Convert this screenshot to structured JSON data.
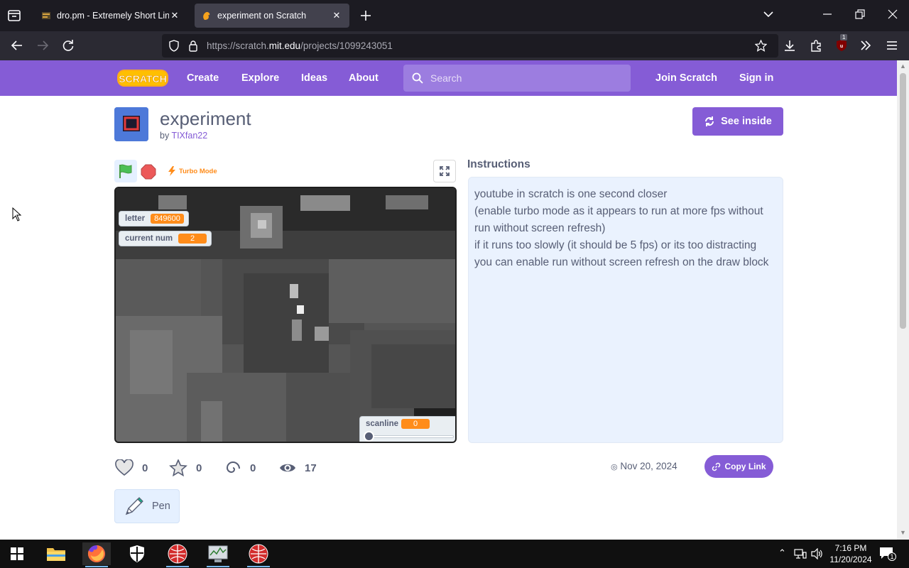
{
  "browser": {
    "tabs": [
      {
        "label": "dro.pm - Extremely Short Links",
        "active": false
      },
      {
        "label": "experiment on Scratch",
        "active": true
      }
    ],
    "url": {
      "prefix": "https://scratch.",
      "host": "mit.edu",
      "path": "/projects/1099243051"
    },
    "extension_badge": "1"
  },
  "scratch": {
    "logo_text": "SCRATCH",
    "nav": {
      "create": "Create",
      "explore": "Explore",
      "ideas": "Ideas",
      "about": "About"
    },
    "search": {
      "placeholder": "Search"
    },
    "join": "Join Scratch",
    "signin": "Sign in"
  },
  "project": {
    "title": "experiment",
    "by": "by",
    "author": "TIXfan22",
    "see_inside": "See inside",
    "turbo": "Turbo Mode",
    "monitors": {
      "letter": {
        "label": "letter",
        "value": "849600"
      },
      "current_num": {
        "label": "current num",
        "value": "2"
      },
      "scanline": {
        "label": "scanline",
        "value": "0"
      }
    },
    "instructions_heading": "Instructions",
    "instructions": [
      "youtube in scratch is one second closer",
      "(enable turbo mode as it appears to run at more fps without run without screen refresh)",
      "if it runs too slowly (it should be 5 fps) or its too distracting you can enable run without screen refresh on the draw block"
    ],
    "stats": {
      "loves": "0",
      "favorites": "0",
      "remixes": "0",
      "views": "17"
    },
    "date": "Nov 20, 2024",
    "copy_link": "Copy Link",
    "extension": "Pen"
  },
  "taskbar": {
    "clock_time": "7:16 PM",
    "clock_date": "11/20/2024",
    "notifications": "1"
  },
  "colors": {
    "scratch_purple": "#855cd6",
    "monitor_orange": "#ff8c1a",
    "text_gray": "#575e75",
    "instructions_bg": "#eaf2fe"
  }
}
